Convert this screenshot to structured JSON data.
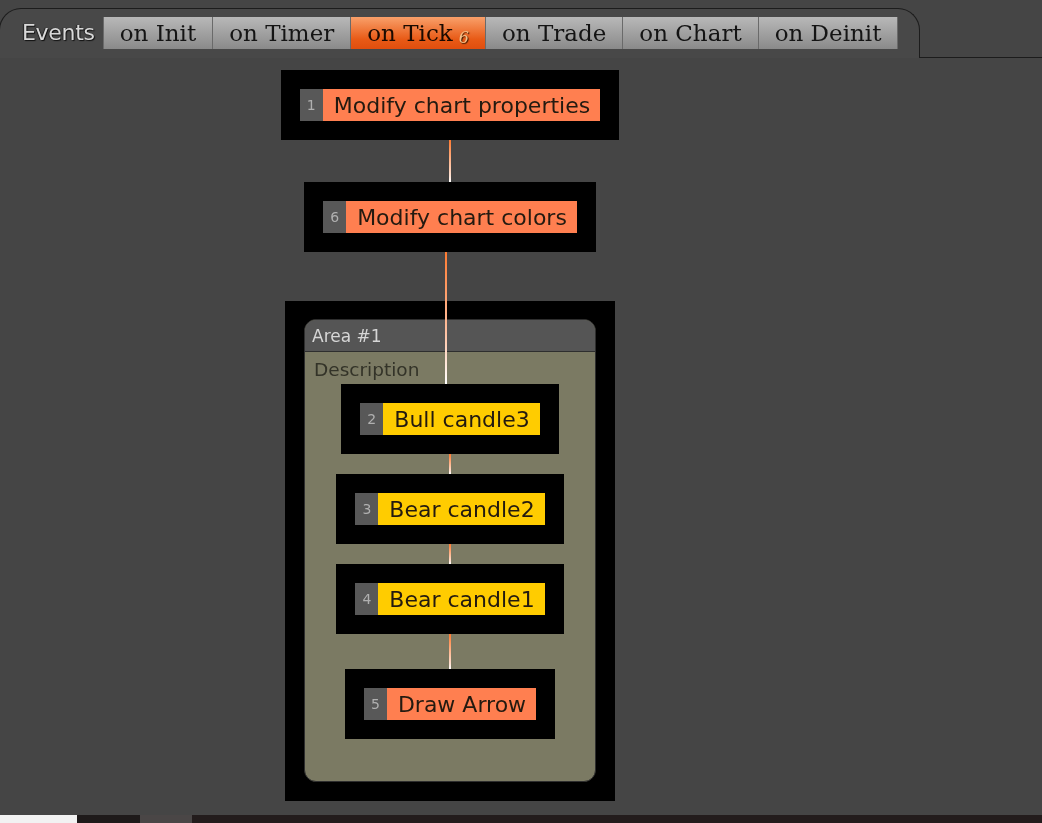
{
  "toolbar": {
    "label": "Events"
  },
  "tabs": [
    {
      "label": "on Init",
      "selected": false
    },
    {
      "label": "on Timer",
      "selected": false
    },
    {
      "label": "on Tick",
      "selected": true,
      "badge": "6"
    },
    {
      "label": "on Trade",
      "selected": false
    },
    {
      "label": "on Chart",
      "selected": false
    },
    {
      "label": "on Deinit",
      "selected": false
    }
  ],
  "flow": [
    {
      "kind": "node",
      "number": "1",
      "label": "Modify chart properties",
      "color": "#ff7f50"
    },
    {
      "kind": "node",
      "number": "6",
      "label": "Modify chart colors",
      "color": "#ff7f50"
    },
    {
      "kind": "area",
      "title": "Area #1",
      "description": "Description",
      "children": [
        {
          "kind": "node",
          "number": "2",
          "label": "Bull candle3",
          "color": "#ffcc00"
        },
        {
          "kind": "node",
          "number": "3",
          "label": "Bear candle2",
          "color": "#ffcc00"
        },
        {
          "kind": "node",
          "number": "4",
          "label": "Bear candle1",
          "color": "#ffcc00"
        },
        {
          "kind": "node",
          "number": "5",
          "label": "Draw Arrow",
          "color": "#ff7f50"
        }
      ]
    }
  ]
}
